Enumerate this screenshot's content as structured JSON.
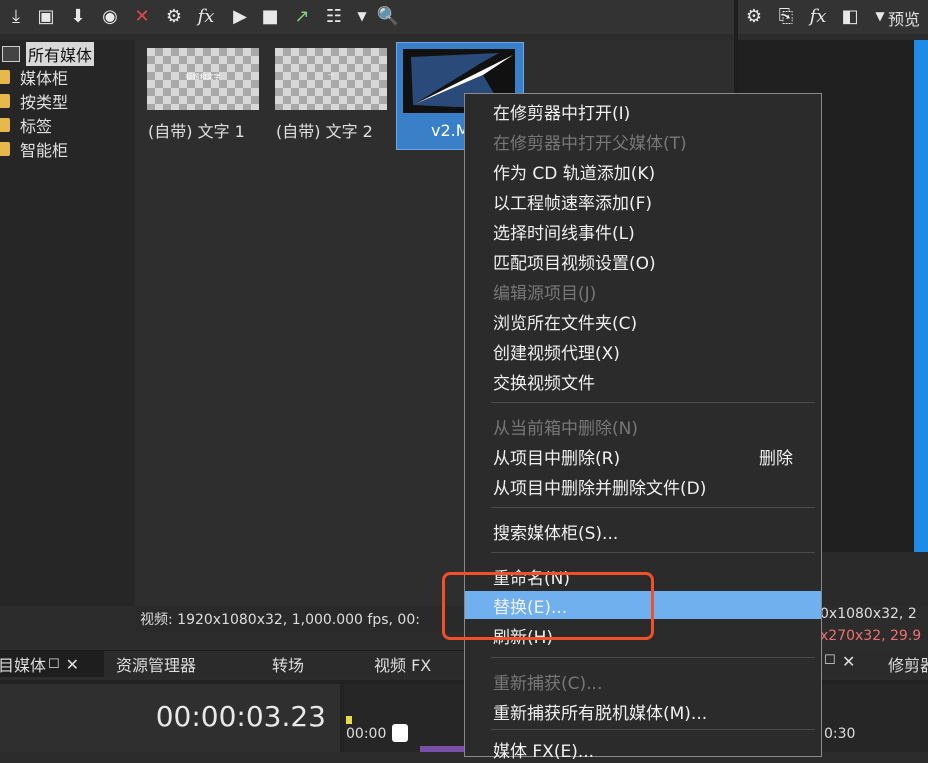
{
  "toolbar": {
    "icons": [
      "import-media-icon",
      "capture-icon",
      "get-media-icon",
      "disc-icon",
      "delete-icon",
      "properties-icon",
      "media-fx-icon",
      "play-icon",
      "stop-icon",
      "auto-preview-icon",
      "views-icon",
      "views-dropdown-icon",
      "zoom-icon"
    ],
    "fx_label": "fx"
  },
  "right_toolbar": {
    "fx_label": "fx",
    "preview_label": "预览"
  },
  "tree": {
    "items": [
      "所有媒体",
      "媒体柜",
      "按类型",
      "标签",
      "智能柜"
    ]
  },
  "media": {
    "items": [
      {
        "label": "(自带) 文字 1",
        "thumb_text": "标题和文字"
      },
      {
        "label": "(自带) 文字 2",
        "thumb_text": "--"
      },
      {
        "label": "v2.M"
      }
    ]
  },
  "status": {
    "text": "视频: 1920x1080x32, 1,000.000 fps, 00:"
  },
  "right_status": {
    "line1": "0x1080x32, 2",
    "line2": "x270x32, 29.9"
  },
  "tabs": {
    "items": [
      "目媒体",
      "资源管理器",
      "转场",
      "视频 FX"
    ],
    "right_label": "修剪器"
  },
  "timeline": {
    "timecode": "00:00:03.23",
    "ruler_start": "00:00",
    "ruler_right": "0:30"
  },
  "menu": {
    "items": [
      {
        "label": "在修剪器中打开(I)",
        "disabled": false
      },
      {
        "label": "在修剪器中打开父媒体(T)",
        "disabled": true
      },
      {
        "label": "作为 CD 轨道添加(K)",
        "disabled": false
      },
      {
        "label": "以工程帧速率添加(F)",
        "disabled": false
      },
      {
        "label": "选择时间线事件(L)",
        "disabled": false
      },
      {
        "label": "匹配项目视频设置(O)",
        "disabled": false
      },
      {
        "label": "编辑源项目(J)",
        "disabled": true
      },
      {
        "label": "浏览所在文件夹(C)",
        "disabled": false
      },
      {
        "label": "创建视频代理(X)",
        "disabled": false
      },
      {
        "label": "交换视频文件",
        "disabled": false
      },
      {
        "label": "从当前箱中删除(N)",
        "disabled": true
      },
      {
        "label": "从项目中删除(R)",
        "disabled": false,
        "shortcut": "删除"
      },
      {
        "label": "从项目中删除并删除文件(D)",
        "disabled": false
      },
      {
        "label": "搜索媒体柜(S)...",
        "disabled": false
      },
      {
        "label": "重命名(N)",
        "disabled": false
      },
      {
        "label": "替换(E)...",
        "disabled": false,
        "highlighted": true
      },
      {
        "label": "刷新(H)",
        "disabled": false
      },
      {
        "label": "重新捕获(C)...",
        "disabled": true
      },
      {
        "label": "重新捕获所有脱机媒体(M)...",
        "disabled": false
      },
      {
        "label": "媒体 FX(E)...",
        "disabled": false
      }
    ]
  },
  "colors": {
    "highlight": "#70b0ef",
    "annotation": "#f0502a",
    "selection": "#3a80c8",
    "accent_blue": "#1e8be6"
  }
}
